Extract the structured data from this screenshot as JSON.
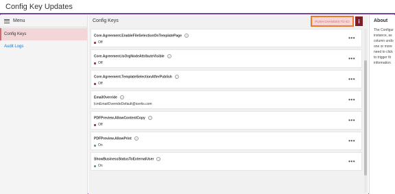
{
  "app": {
    "title": "Config Key Updates"
  },
  "sidebar": {
    "menu_label": "Menu",
    "items": [
      {
        "label": "Config Keys",
        "active": true
      },
      {
        "label": "Audit Logs",
        "active": false
      }
    ]
  },
  "main": {
    "section_title": "Config Keys",
    "push_button_label": "PUSH CHANGES TO ICI",
    "info_button_label": "i",
    "keys": [
      {
        "name": "Core.Agreement.EnableFileSelectionOnTemplatePage",
        "type": "status",
        "value": "Off"
      },
      {
        "name": "Core.Agreement.IsOrgNodeAttributeVisible",
        "type": "status",
        "value": "Off"
      },
      {
        "name": "Core.Agreement.TemplateSelectionAfterPublish",
        "type": "status",
        "value": "Off"
      },
      {
        "name": "EmailOverride",
        "type": "text",
        "value": "IcmEmailOverrideDefault@icertis.com"
      },
      {
        "name": "PDFPreview.AllowContentCopy",
        "type": "status",
        "value": "Off"
      },
      {
        "name": "PDFPreview.AllowPrint",
        "type": "status",
        "value": "On"
      },
      {
        "name": "ShowBusinessStatusToExternalUser",
        "type": "status",
        "value": "On"
      }
    ],
    "more_label": "•••",
    "help_label": "?"
  },
  "about": {
    "title": "About",
    "lines": [
      "The Configur",
      "instance, as",
      "column undo",
      "one or more",
      "need to click",
      "to trigger th",
      "information"
    ]
  },
  "colors": {
    "accent": "#7a3f9c",
    "highlight_border": "#e87b2e",
    "off": "#d0342c",
    "on": "#2fa84f",
    "link": "#1a73c8"
  }
}
